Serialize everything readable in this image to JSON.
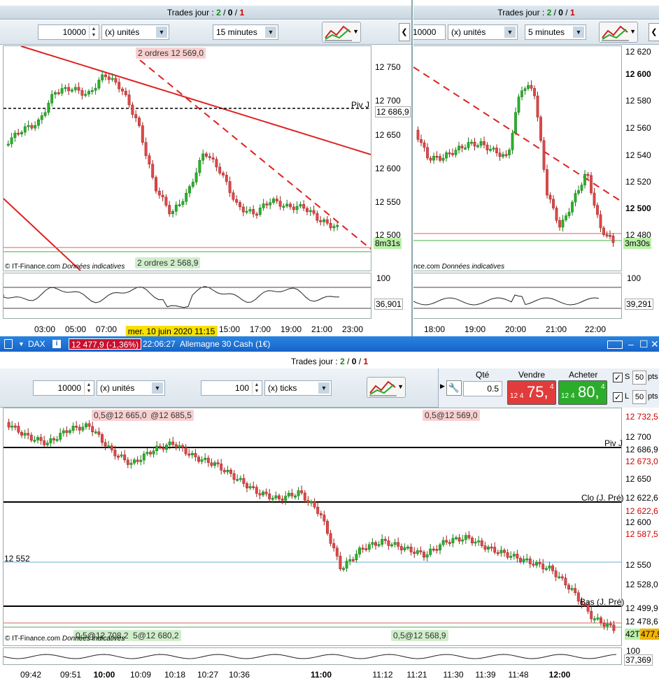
{
  "left_pane": {
    "trades": {
      "prefix": "Trades jour : ",
      "a": "2",
      "sep1": " / ",
      "b": "0",
      "sep2": " / ",
      "c": "1"
    },
    "qty": "10000",
    "qty_unit": "(x) unités",
    "timeframe": "15 minutes",
    "price_labels": [
      "12 750",
      "12 700",
      "12 650",
      "12 600",
      "12 550",
      "12 500"
    ],
    "piv_label": "Piv J",
    "piv_value": "12 686,9",
    "countdown": "8m31s",
    "order_top": {
      "count": "2 ordres",
      "price": "12 569,0"
    },
    "order_bottom": {
      "count": "2 ordres",
      "price": "2 568,9"
    },
    "copyright": "© IT-Finance.com",
    "disclaimer": "Données indicatives",
    "osc_top": "100",
    "osc_value": "36,901",
    "times": [
      "03:00",
      "05:00",
      "07:00",
      "15:00",
      "17:00",
      "19:00",
      "21:00",
      "23:00"
    ],
    "date_tooltip": "mer. 10 juin 2020 11:15"
  },
  "right_pane": {
    "trades": {
      "prefix": "Trades jour : ",
      "a": "2",
      "sep1": " / ",
      "b": "0",
      "sep2": " / ",
      "c": "1"
    },
    "qty": "10000",
    "qty_unit": "(x) unités",
    "timeframe": "5 minutes",
    "price_labels": [
      "12 620",
      "12 600",
      "12 580",
      "12 560",
      "12 540",
      "12 520",
      "12 500",
      "12 480"
    ],
    "countdown": "3m30s",
    "footer": "nce.com",
    "disclaimer": "Données indicatives",
    "osc_top": "100",
    "osc_value": "39,291",
    "times": [
      "18:00",
      "19:00",
      "20:00",
      "21:00",
      "22:00"
    ]
  },
  "bottom_pane": {
    "symbol": "DAX",
    "info": "i",
    "price_badge": "12 477,9 (-1,36%)",
    "clock": "22:06:27",
    "instrument": "Allemagne 30 Cash (1€)",
    "trades": {
      "prefix": "Trades jour : ",
      "a": "2",
      "sep1": " / ",
      "b": "0",
      "sep2": " / ",
      "c": "1"
    },
    "qty": "10000",
    "qty_unit": "(x) unités",
    "ticks": "100",
    "ticks_unit": "(x) ticks",
    "qte_label": "Qté",
    "qte_value": "0.5",
    "sell": {
      "label": "Vendre",
      "prefix": "12 4",
      "big": "75,",
      "sup": "4"
    },
    "buy": {
      "label": "Acheter",
      "prefix": "12 4",
      "big": "80,",
      "sup": "4"
    },
    "s_label": "S",
    "s_value": "50",
    "s_unit": "pts",
    "l_label": "L",
    "l_value": "50",
    "l_unit": "pts",
    "price_labels": [
      {
        "t": "12 732,5",
        "c": "#d00000"
      },
      {
        "t": "12 700",
        "c": "#000"
      },
      {
        "t": "12 686,9",
        "c": "#000"
      },
      {
        "t": "12 673,0",
        "c": "#d00000"
      },
      {
        "t": "12 650",
        "c": "#000"
      },
      {
        "t": "12 622,6",
        "c": "#000"
      },
      {
        "t": "12 622,6",
        "c": "#d00000"
      },
      {
        "t": "12 600",
        "c": "#000"
      },
      {
        "t": "12 587,5",
        "c": "#d00000"
      },
      {
        "t": "12 550",
        "c": "#000"
      },
      {
        "t": "12 528,0",
        "c": "#000"
      },
      {
        "t": "12 499,9",
        "c": "#000"
      },
      {
        "t": "12 478,6",
        "c": "#000"
      }
    ],
    "line_labels": {
      "piv": "Piv J",
      "close": "Clo (J. Pré)",
      "low": "Bas (J. Pré)",
      "level": "12 552"
    },
    "orders_red": [
      "0,5@12 665,0",
      "@12 685,5",
      "0,5@12 569,0"
    ],
    "orders_green": [
      "0,5@12 708,2",
      "5@12 680,2",
      "0,5@12 568,9"
    ],
    "tick_label": "42T",
    "last_price": "477,9",
    "copyright": "© IT-Finance.com",
    "disclaimer": "Données indicatives",
    "osc_top": "100",
    "osc_value": "37,369",
    "times": [
      "09:42",
      "09:51",
      "10:00",
      "10:09",
      "10:18",
      "10:27",
      "10:36",
      "11:00",
      "11:12",
      "11:21",
      "11:30",
      "11:39",
      "11:48",
      "12:00"
    ]
  },
  "colors": {
    "up": "#27b327",
    "down": "#e04848",
    "sell_btn": "#e23b3b",
    "buy_btn": "#2bad2b",
    "accent": "#1763c8",
    "badge": "#c8102e"
  }
}
